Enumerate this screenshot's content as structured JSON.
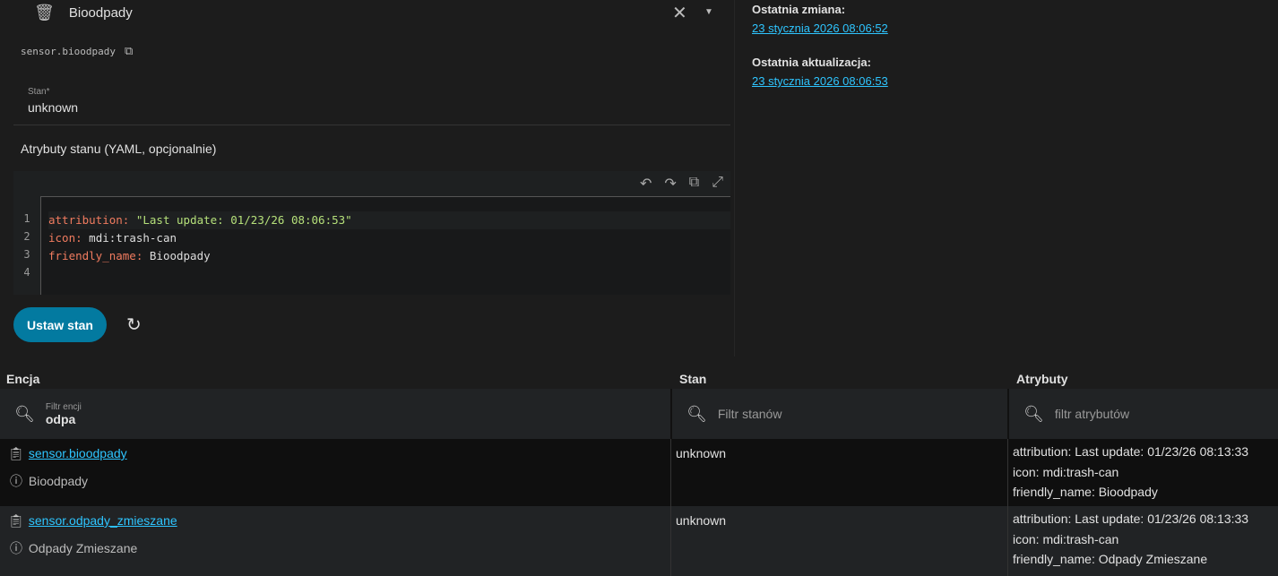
{
  "dialog": {
    "title": "Bioodpady",
    "entity_id": "sensor.bioodpady",
    "state_label": "Stan*",
    "state_value": "unknown",
    "attributes_label": "Atrybuty stanu (YAML, opcjonalnie)",
    "yaml": [
      {
        "n": "1",
        "key": "attribution",
        "val": "\"Last update: 01/23/26 08:06:53\""
      },
      {
        "n": "2",
        "key": "icon",
        "val": "mdi:trash-can"
      },
      {
        "n": "3",
        "key": "friendly_name",
        "val": "Bioodpady"
      },
      {
        "n": "4"
      }
    ],
    "set_button": "Ustaw stan"
  },
  "meta": {
    "last_changed_label": "Ostatnia zmiana:",
    "last_changed": "23 stycznia 2026 08:06:52",
    "last_updated_label": "Ostatnia aktualizacja:",
    "last_updated": "23 stycznia 2026 08:06:53"
  },
  "table": {
    "headers": [
      "Encja",
      "Stan",
      "Atrybuty"
    ],
    "filters": {
      "entity_label": "Filtr encji",
      "entity_value": "odpa",
      "state_placeholder": "Filtr stanów",
      "attr_placeholder": "filtr atrybutów"
    },
    "rows": [
      {
        "entity": "sensor.bioodpady",
        "name": "Bioodpady",
        "state": "unknown",
        "attrs": [
          "attribution: Last update: 01/23/26 08:13:33",
          "icon: mdi:trash-can",
          "friendly_name: Bioodpady"
        ]
      },
      {
        "entity": "sensor.odpady_zmieszane",
        "name": "Odpady Zmieszane",
        "state": "unknown",
        "attrs": [
          "attribution: Last update: 01/23/26 08:13:33",
          "icon: mdi:trash-can",
          "friendly_name: Odpady Zmieszane"
        ]
      }
    ]
  }
}
